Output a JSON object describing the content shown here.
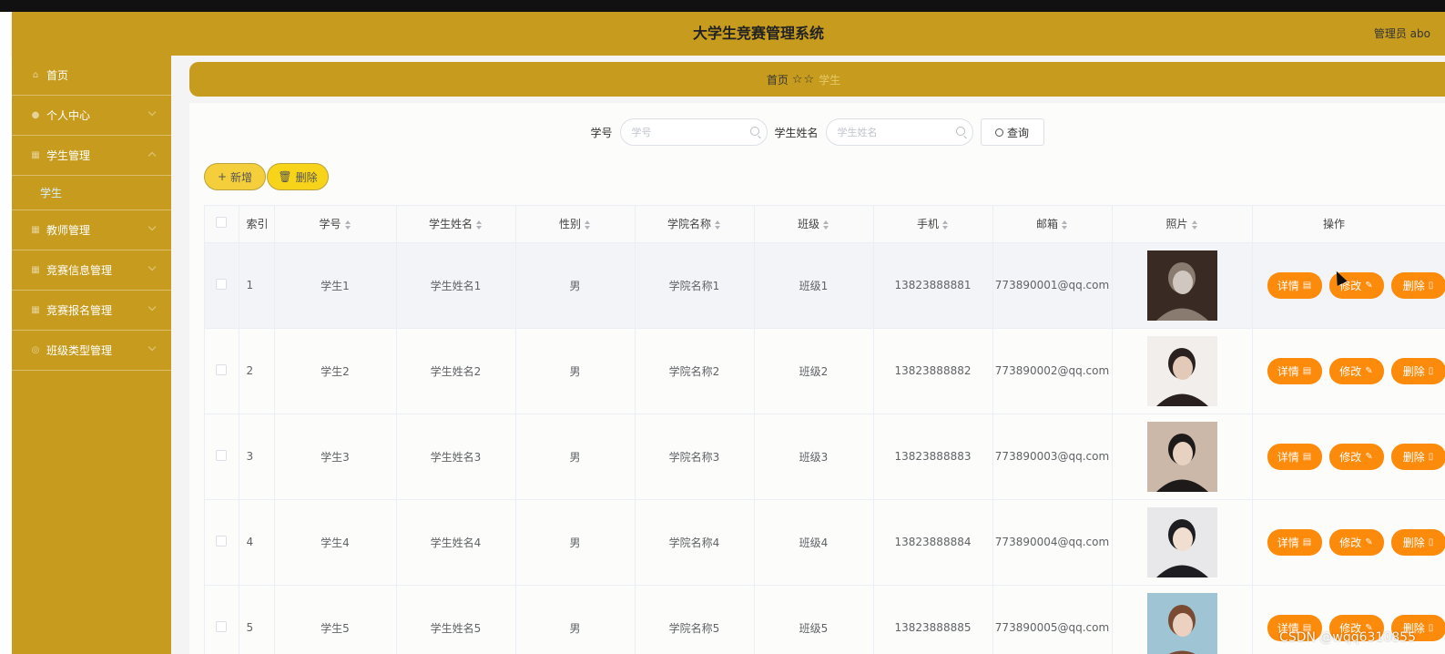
{
  "app": {
    "title": "大学生竞赛管理系统",
    "user": "管理员 abo"
  },
  "sidebar": {
    "items": [
      {
        "label": "首页",
        "icon": "home-icon"
      },
      {
        "label": "个人中心",
        "icon": "user-icon"
      },
      {
        "label": "学生管理",
        "icon": "grid-icon",
        "expanded": true,
        "children": [
          {
            "label": "学生"
          }
        ]
      },
      {
        "label": "教师管理",
        "icon": "grid-icon"
      },
      {
        "label": "竞赛信息管理",
        "icon": "grid-icon"
      },
      {
        "label": "竞赛报名管理",
        "icon": "grid-icon"
      },
      {
        "label": "班级类型管理",
        "icon": "info-icon"
      }
    ]
  },
  "breadcrumb": {
    "home": "首页",
    "separator": "☆☆",
    "current": "学生"
  },
  "search": {
    "student_id_label": "学号",
    "student_id_placeholder": "学号",
    "student_name_label": "学生姓名",
    "student_name_placeholder": "学生姓名",
    "query_label": "查询"
  },
  "actions": {
    "add_label": "新增",
    "delete_label": "删除"
  },
  "table": {
    "columns": [
      "索引",
      "学号",
      "学生姓名",
      "性别",
      "学院名称",
      "班级",
      "手机",
      "邮箱",
      "照片",
      "操作"
    ],
    "rows": [
      {
        "index": "1",
        "id": "学生1",
        "name": "学生姓名1",
        "gender": "男",
        "college": "学院名称1",
        "class": "班级1",
        "phone": "13823888881",
        "email": "773890001@qq.com"
      },
      {
        "index": "2",
        "id": "学生2",
        "name": "学生姓名2",
        "gender": "男",
        "college": "学院名称2",
        "class": "班级2",
        "phone": "13823888882",
        "email": "773890002@qq.com"
      },
      {
        "index": "3",
        "id": "学生3",
        "name": "学生姓名3",
        "gender": "男",
        "college": "学院名称3",
        "class": "班级3",
        "phone": "13823888883",
        "email": "773890003@qq.com"
      },
      {
        "index": "4",
        "id": "学生4",
        "name": "学生姓名4",
        "gender": "男",
        "college": "学院名称4",
        "class": "班级4",
        "phone": "13823888884",
        "email": "773890004@qq.com"
      },
      {
        "index": "5",
        "id": "学生5",
        "name": "学生姓名5",
        "gender": "男",
        "college": "学院名称5",
        "class": "班级5",
        "phone": "13823888885",
        "email": "773890005@qq.com"
      }
    ],
    "op_labels": {
      "detail": "详情",
      "edit": "修改",
      "delete": "删除"
    }
  },
  "watermark": "CSDN @wqq6310855",
  "colors": {
    "header": "#c79c1e",
    "sidebar": "#c79c1e",
    "op_button": "#fc8a0b",
    "add_button": "#f4cf3b",
    "delete_button": "#f7d41a"
  }
}
